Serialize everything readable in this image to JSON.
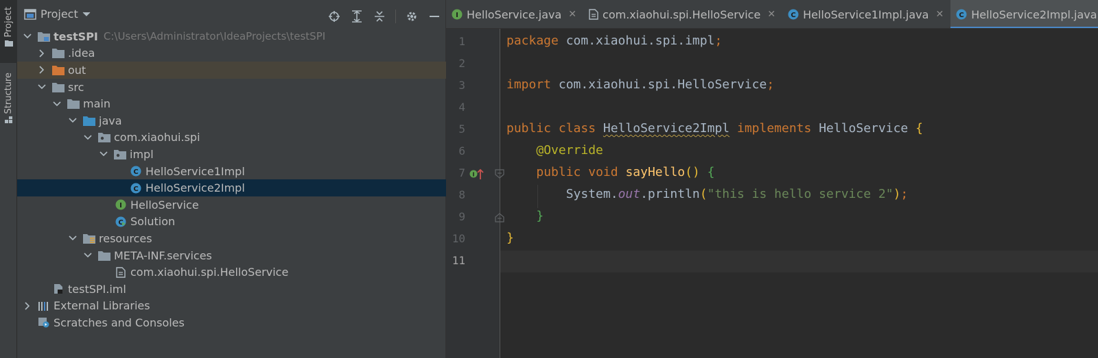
{
  "strip": {
    "project_label": "Project",
    "structure_label": "Structure"
  },
  "panel": {
    "title": "Project"
  },
  "tree": [
    {
      "label": "testSPI",
      "path": "C:\\Users\\Administrator\\IdeaProjects\\testSPI",
      "depth": 0,
      "chevron": "down",
      "icon": "module-folder-icon"
    },
    {
      "label": ".idea",
      "depth": 1,
      "chevron": "right",
      "icon": "folder-icon"
    },
    {
      "label": "out",
      "depth": 1,
      "chevron": "right",
      "icon": "excluded-folder-icon"
    },
    {
      "label": "src",
      "depth": 1,
      "chevron": "down",
      "icon": "folder-icon"
    },
    {
      "label": "main",
      "depth": 2,
      "chevron": "down",
      "icon": "folder-icon"
    },
    {
      "label": "java",
      "depth": 3,
      "chevron": "down",
      "icon": "source-folder-icon"
    },
    {
      "label": "com.xiaohui.spi",
      "depth": 4,
      "chevron": "down",
      "icon": "package-icon"
    },
    {
      "label": "impl",
      "depth": 5,
      "chevron": "down",
      "icon": "package-icon"
    },
    {
      "label": "HelloService1Impl",
      "depth": 6,
      "chevron": "none",
      "icon": "class-icon"
    },
    {
      "label": "HelloService2Impl",
      "depth": 6,
      "chevron": "none",
      "icon": "class-icon"
    },
    {
      "label": "HelloService",
      "depth": 5,
      "chevron": "none",
      "icon": "interface-icon"
    },
    {
      "label": "Solution",
      "depth": 5,
      "chevron": "none",
      "icon": "runnable-class-icon"
    },
    {
      "label": "resources",
      "depth": 3,
      "chevron": "down",
      "icon": "resources-folder-icon"
    },
    {
      "label": "META-INF.services",
      "depth": 4,
      "chevron": "down",
      "icon": "folder-icon"
    },
    {
      "label": "com.xiaohui.spi.HelloService",
      "depth": 5,
      "chevron": "none",
      "icon": "text-file-icon"
    },
    {
      "label": "testSPI.iml",
      "depth": 2,
      "chevron": "none",
      "icon": "iml-file-icon"
    },
    {
      "label": "External Libraries",
      "depth": 0,
      "chevron": "right",
      "icon": "libraries-icon"
    },
    {
      "label": "Scratches and Consoles",
      "depth": 0,
      "chevron": "none",
      "icon": "scratches-icon"
    }
  ],
  "tabs": [
    {
      "label": "HelloService.java",
      "icon": "interface-icon"
    },
    {
      "label": "com.xiaohui.spi.HelloService",
      "icon": "text-file-icon"
    },
    {
      "label": "HelloService1Impl.java",
      "icon": "class-icon"
    },
    {
      "label": "HelloService2Impl.java",
      "icon": "class-icon"
    }
  ],
  "editor": {
    "line_numbers": [
      "1",
      "2",
      "3",
      "4",
      "5",
      "6",
      "7",
      "8",
      "9",
      "10",
      "11"
    ],
    "tokens": {
      "package_kw": "package",
      "package_name": "com.xiaohui.spi.impl",
      "semi": ";",
      "import_kw": "import",
      "import_name": "com.xiaohui.spi.HelloService",
      "public_kw": "public",
      "class_kw": "class",
      "class_name": "HelloService2Impl",
      "implements_kw": "implements",
      "interface_name": "HelloService",
      "brace_open": "{",
      "brace_close": "}",
      "annotation": "@Override",
      "void_kw": "void",
      "method_name": "sayHello",
      "parens": "()",
      "paren_open": "(",
      "paren_close": ")",
      "system": "System.",
      "out_field": "out",
      "println": ".println",
      "string": "\"this is hello service 2\""
    }
  }
}
